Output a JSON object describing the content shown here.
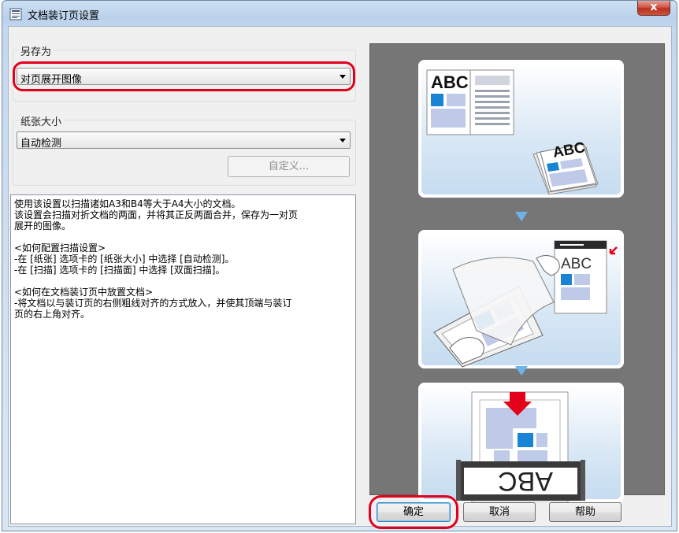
{
  "window": {
    "title": "文档装订页设置",
    "close_label": "x"
  },
  "save_as": {
    "legend": "另存为",
    "selected": "对页展开图像"
  },
  "paper_size": {
    "legend": "纸张大小",
    "selected": "自动检测",
    "custom_button": "自定义..."
  },
  "description": "使用该设置以扫描诸如A3和B4等大于A4大小的文档。\n该设置会扫描对折文档的两面，并将其正反两面合并，保存为一对页\n展开的图像。\n\n<如何配置扫描设置>\n-在 [纸张] 选项卡的 [纸张大小] 中选择 [自动检测]。\n-在 [扫描] 选项卡的 [扫描面] 中选择 [双面扫描]。\n\n<如何在文档装订页中放置文档>\n-将文档以与装订页的右侧粗线对齐的方式放入，并使其顶端与装订\n页的右上角对齐。",
  "illustration": {
    "step1_text": "ABC",
    "step2_text": "ABC",
    "step3_text": "ABC"
  },
  "buttons": {
    "ok": "确定",
    "cancel": "取消",
    "help": "帮助"
  },
  "colors": {
    "highlight_ring": "#e3001b",
    "accent_blue": "#1a84d4",
    "panel_bg": "#767676"
  }
}
